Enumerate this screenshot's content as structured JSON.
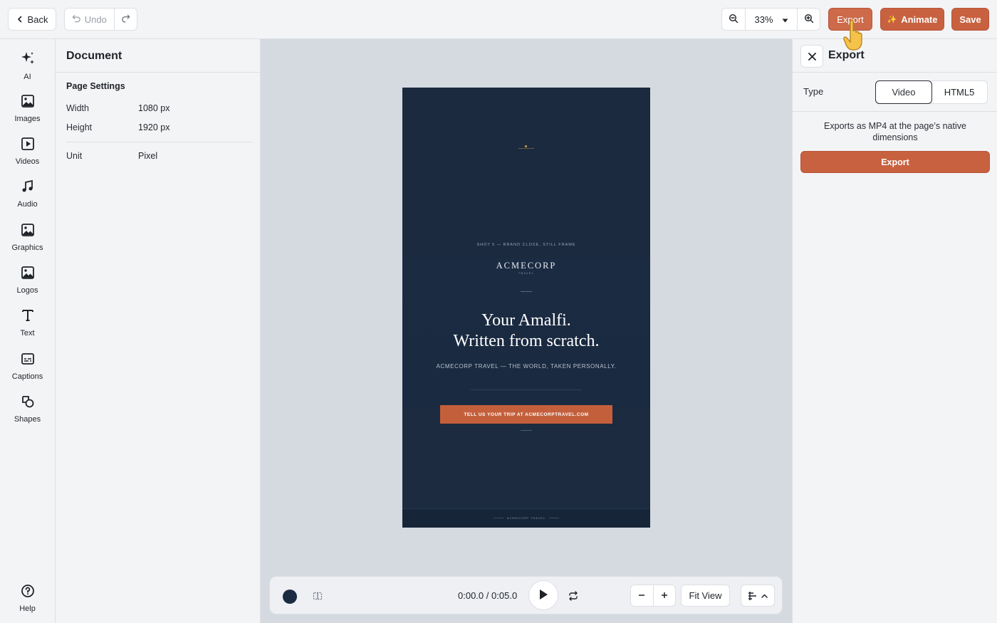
{
  "topbar": {
    "back_label": "Back",
    "undo_label": "Undo",
    "zoom_value": "33%",
    "export_label": "Export",
    "animate_label": "Animate",
    "save_label": "Save"
  },
  "rail": {
    "items": [
      {
        "label": "AI",
        "icon": "sparkle-icon"
      },
      {
        "label": "Images",
        "icon": "image-icon"
      },
      {
        "label": "Videos",
        "icon": "video-icon"
      },
      {
        "label": "Audio",
        "icon": "music-icon"
      },
      {
        "label": "Graphics",
        "icon": "graphic-icon"
      },
      {
        "label": "Logos",
        "icon": "logo-icon"
      },
      {
        "label": "Text",
        "icon": "text-icon"
      },
      {
        "label": "Captions",
        "icon": "captions-icon"
      },
      {
        "label": "Shapes",
        "icon": "shapes-icon"
      }
    ],
    "help_label": "Help"
  },
  "document": {
    "title": "Document",
    "section_title": "Page Settings",
    "width_label": "Width",
    "width_value": "1080 px",
    "height_label": "Height",
    "height_value": "1920 px",
    "unit_label": "Unit",
    "unit_value": "Pixel"
  },
  "artboard": {
    "shot_label": "SHOT 5 — BRAND CLOSE, STILL FRAME",
    "logo": "ACMECORP",
    "logo_sub": "TRAVEL",
    "headline_line1": "Your Amalfi.",
    "headline_line2": "Written from scratch.",
    "tagline": "ACMECORP TRAVEL — THE WORLD, TAKEN PERSONALLY.",
    "cta": "TELL US YOUR TRIP AT ACMECORPTRAVEL.COM",
    "footer": "ACMECORP TRAVEL",
    "bg_color": "#1a2a40",
    "accent_color": "#c45f3c"
  },
  "controls": {
    "time_current": "0:00.0",
    "time_separator": "/",
    "time_total": "0:05.0",
    "fit_view_label": "Fit View"
  },
  "export_panel": {
    "title": "Export",
    "type_label": "Type",
    "type_options": [
      "Video",
      "HTML5"
    ],
    "selected_type": "Video",
    "description": "Exports as MP4 at the page’s native dimensions",
    "export_button_label": "Export"
  }
}
